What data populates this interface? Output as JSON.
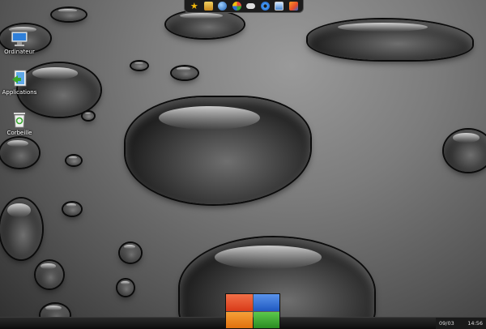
{
  "desktop": {
    "icons": [
      {
        "label": "Ordinateur",
        "icon": "computer-icon"
      },
      {
        "label": "Applications",
        "icon": "applications-icon"
      },
      {
        "label": "Corbeille",
        "icon": "recycle-bin-icon"
      }
    ]
  },
  "dock": {
    "icons": [
      "star-icon",
      "folder-icon",
      "globe-icon",
      "apps-icon",
      "gamepad-icon",
      "settings-gear-icon",
      "display-icon",
      "package-icon"
    ]
  },
  "taskbar": {
    "date": "09/03",
    "time": "14:56"
  },
  "colors": {
    "start_red": "#e8502a",
    "start_blue": "#2f6fd6",
    "start_orange": "#f08a1e",
    "start_green": "#3aa830"
  }
}
